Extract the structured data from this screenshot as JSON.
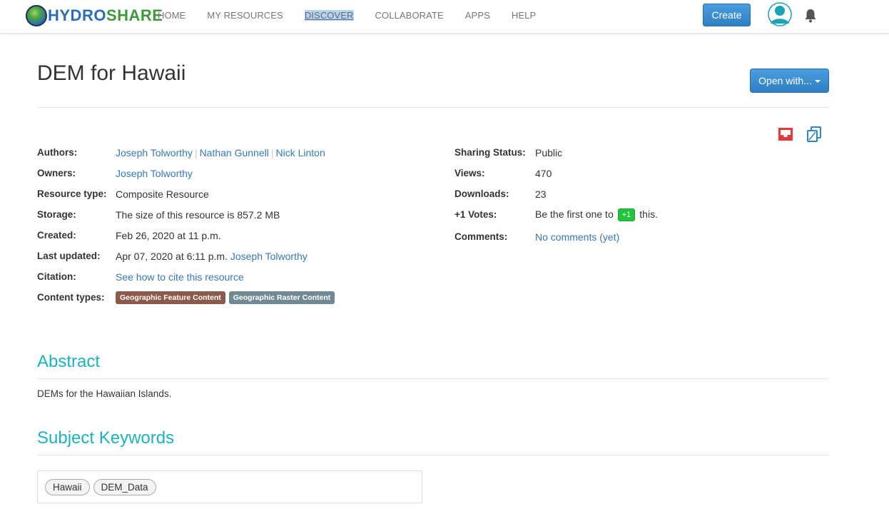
{
  "nav": {
    "logo_part1": "HYDRO",
    "logo_part2": "SHARE",
    "links": [
      "HOME",
      "MY RESOURCES",
      "DISCOVER",
      "COLLABORATE",
      "APPS",
      "HELP"
    ],
    "create_label": "Create"
  },
  "resource": {
    "title": "DEM for Hawaii",
    "open_with_label": "Open with..."
  },
  "meta_left": {
    "authors_label": "Authors:",
    "authors": [
      "Joseph Tolworthy",
      "Nathan Gunnell",
      "Nick Linton"
    ],
    "owners_label": "Owners:",
    "owner": "Joseph Tolworthy",
    "type_label": "Resource type:",
    "type_value": "Composite Resource",
    "storage_label": "Storage:",
    "storage_value": "The size of this resource is 857.2 MB",
    "created_label": "Created:",
    "created_value": "Feb 26, 2020 at 11 p.m.",
    "updated_label": "Last updated:",
    "updated_value": "Apr 07, 2020 at 6:11 p.m.",
    "updated_by": "Joseph Tolworthy",
    "citation_label": "Citation:",
    "citation_value": "See how to cite this resource",
    "content_label": "Content types:",
    "content_types": [
      {
        "label": "Geographic Feature Content",
        "color": "#8b5a4a"
      },
      {
        "label": "Geographic Raster Content",
        "color": "#6f8a94"
      }
    ]
  },
  "meta_right": {
    "sharing_label": "Sharing Status:",
    "sharing_value": "Public",
    "views_label": "Views:",
    "views_value": "470",
    "downloads_label": "Downloads:",
    "downloads_value": "23",
    "votes_label": "+1 Votes:",
    "votes_prefix": "Be the first one to",
    "votes_button": "+1",
    "votes_suffix": "this.",
    "comments_label": "Comments:",
    "comments_value": "No comments (yet)"
  },
  "abstract": {
    "title": "Abstract",
    "text": "DEMs for the Hawaiian Islands."
  },
  "keywords": {
    "title": "Subject Keywords",
    "items": [
      "Hawaii",
      "DEM_Data"
    ]
  },
  "colors": {
    "accent": "#19b3c4",
    "link": "#337ab7",
    "primary_button": "#2f7fc2"
  }
}
